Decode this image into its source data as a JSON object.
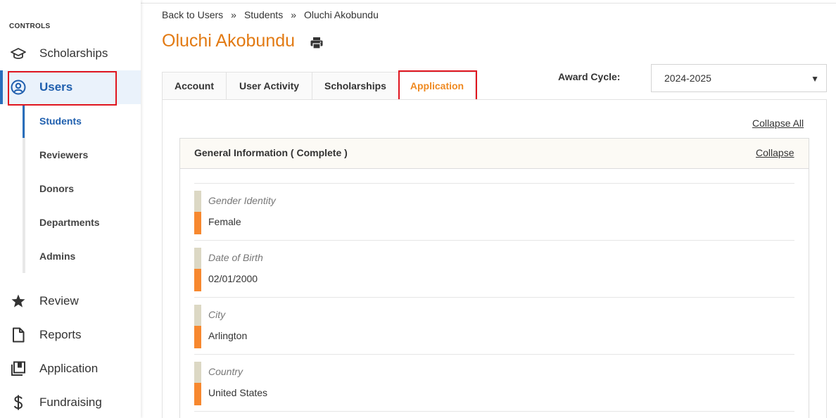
{
  "sidebar": {
    "controls_label": "CONTROLS",
    "items": [
      {
        "label": "Scholarships",
        "icon": "graduation-cap-icon"
      },
      {
        "label": "Users",
        "icon": "user-circle-icon"
      },
      {
        "label": "Review",
        "icon": "star-icon"
      },
      {
        "label": "Reports",
        "icon": "document-icon"
      },
      {
        "label": "Application",
        "icon": "book-icon"
      },
      {
        "label": "Fundraising",
        "icon": "dollar-icon"
      }
    ],
    "sub_items": [
      "Students",
      "Reviewers",
      "Donors",
      "Departments",
      "Admins"
    ],
    "active_item": "Users",
    "active_sub_item": "Students"
  },
  "breadcrumb": {
    "items": [
      "Back to Users",
      "Students",
      "Oluchi Akobundu"
    ],
    "separator": "»"
  },
  "page": {
    "title": "Oluchi Akobundu",
    "print_icon": "print-icon"
  },
  "tabs": [
    "Account",
    "User Activity",
    "Scholarships",
    "Application"
  ],
  "active_tab": "Application",
  "award_cycle": {
    "label": "Award Cycle:",
    "value": "2024-2025"
  },
  "application": {
    "collapse_all": "Collapse All",
    "section_title": "General Information ( Complete )",
    "collapse": "Collapse",
    "fields": [
      {
        "label": "Gender Identity",
        "value": "Female"
      },
      {
        "label": "Date of Birth",
        "value": "02/01/2000"
      },
      {
        "label": "City",
        "value": "Arlington"
      },
      {
        "label": "Country",
        "value": "United States"
      }
    ]
  },
  "colors": {
    "accent_orange": "#e27a13",
    "tab_active": "#ef8a22",
    "nav_active": "#1f5fae",
    "highlight_box": "#e0151f"
  }
}
